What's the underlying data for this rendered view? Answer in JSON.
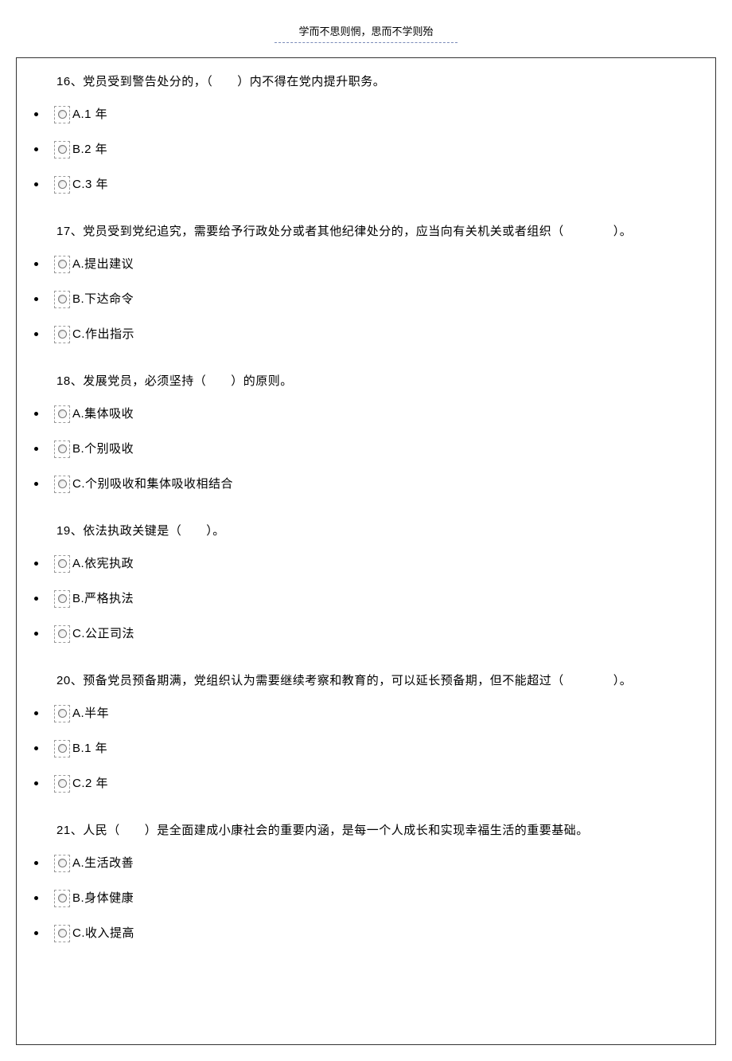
{
  "header": {
    "motto": "学而不思则惘，思而不学则殆"
  },
  "questions": [
    {
      "number": "16",
      "text": "党员受到警告处分的，（　　）内不得在党内提升职务。",
      "options": [
        {
          "key": "A",
          "label": "A.1 年"
        },
        {
          "key": "B",
          "label": "B.2 年"
        },
        {
          "key": "C",
          "label": "C.3 年"
        }
      ]
    },
    {
      "number": "17",
      "text": "党员受到党纪追究，需要给予行政处分或者其他纪律处分的，应当向有关机关或者组织（　　　　）。",
      "options": [
        {
          "key": "A",
          "label": "A.提出建议"
        },
        {
          "key": "B",
          "label": "B.下达命令"
        },
        {
          "key": "C",
          "label": "C.作出指示"
        }
      ]
    },
    {
      "number": "18",
      "text": "发展党员，必须坚持（　　）的原则。",
      "options": [
        {
          "key": "A",
          "label": "A.集体吸收"
        },
        {
          "key": "B",
          "label": "B.个别吸收"
        },
        {
          "key": "C",
          "label": "C.个别吸收和集体吸收相结合"
        }
      ]
    },
    {
      "number": "19",
      "text": "依法执政关键是（　　）。",
      "options": [
        {
          "key": "A",
          "label": "A.依宪执政"
        },
        {
          "key": "B",
          "label": "B.严格执法"
        },
        {
          "key": "C",
          "label": "C.公正司法"
        }
      ]
    },
    {
      "number": "20",
      "text": "预备党员预备期满，党组织认为需要继续考察和教育的，可以延长预备期，但不能超过（　　　　）。",
      "options": [
        {
          "key": "A",
          "label": "A.半年"
        },
        {
          "key": "B",
          "label": "B.1 年"
        },
        {
          "key": "C",
          "label": "C.2 年"
        }
      ]
    },
    {
      "number": "21",
      "text": "人民（　　）是全面建成小康社会的重要内涵，是每一个人成长和实现幸福生活的重要基础。",
      "options": [
        {
          "key": "A",
          "label": "A.生活改善"
        },
        {
          "key": "B",
          "label": "B.身体健康"
        },
        {
          "key": "C",
          "label": "C.收入提高"
        }
      ]
    }
  ],
  "separator": "、"
}
